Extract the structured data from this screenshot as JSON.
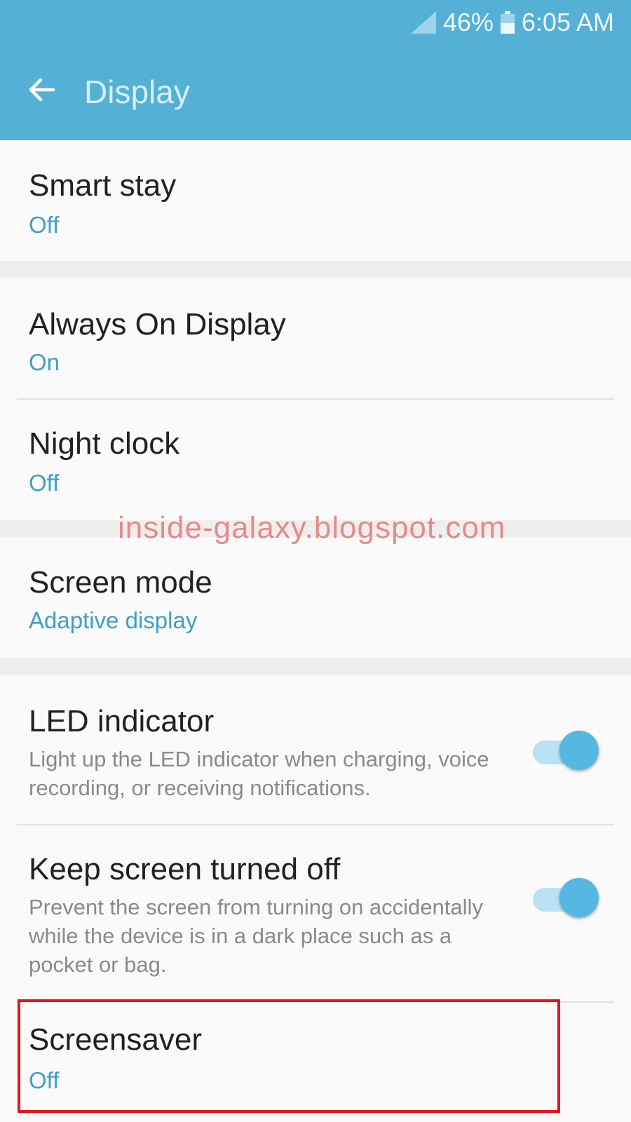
{
  "status_bar": {
    "battery": "46%",
    "time": "6:05 AM",
    "icons": [
      "signal-icon",
      "battery-icon"
    ]
  },
  "header": {
    "title": "Display",
    "back_icon": "arrow-left-icon"
  },
  "items": {
    "smart_stay": {
      "title": "Smart stay",
      "value": "Off"
    },
    "always_on": {
      "title": "Always On Display",
      "value": "On"
    },
    "night_clock": {
      "title": "Night clock",
      "value": "Off"
    },
    "screen_mode": {
      "title": "Screen mode",
      "value": "Adaptive display"
    },
    "led": {
      "title": "LED indicator",
      "desc": "Light up the LED indicator when charging, voice recording, or receiving notifications.",
      "enabled": true
    },
    "keep_off": {
      "title": "Keep screen turned off",
      "desc": "Prevent the screen from turning on accidentally while the device is in a dark place such as a pocket or bag.",
      "enabled": true
    },
    "screensaver": {
      "title": "Screensaver",
      "value": "Off"
    }
  },
  "watermark": "inside-galaxy.blogspot.com",
  "colors": {
    "appbar": "#55b0d6",
    "accent": "#3f9fc4",
    "highlight_border": "#e0151c",
    "watermark": "#e78a8a"
  }
}
